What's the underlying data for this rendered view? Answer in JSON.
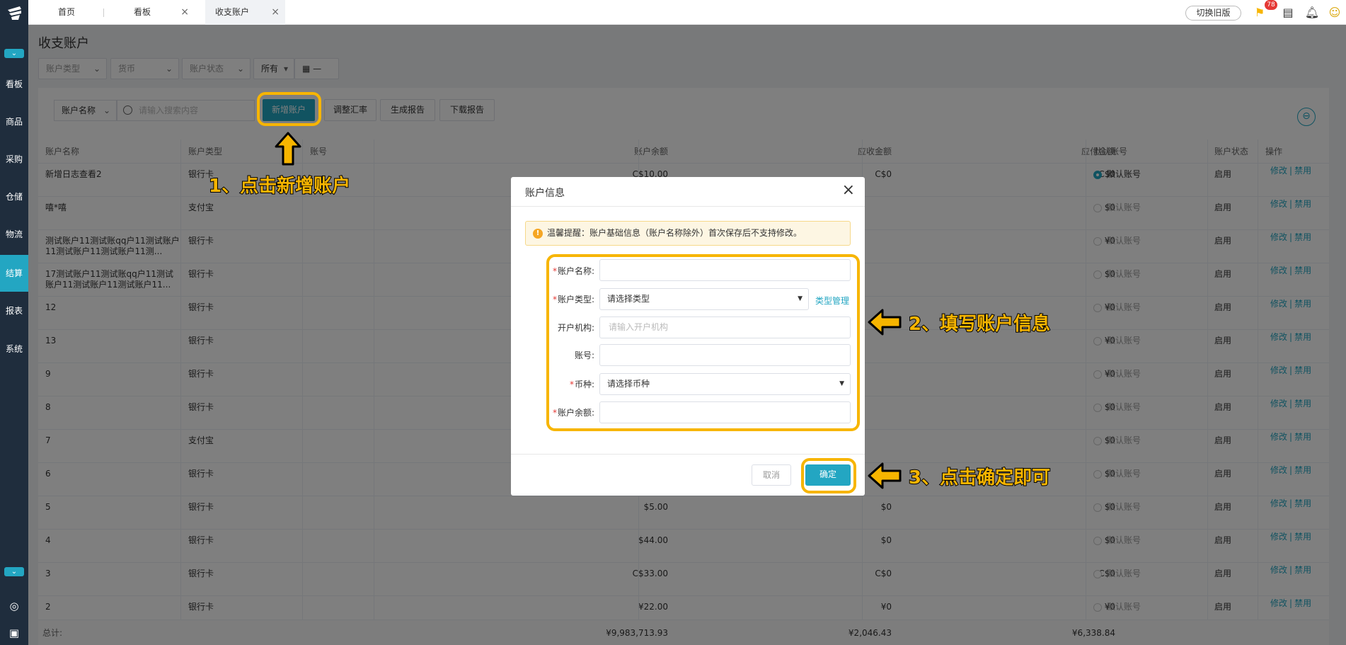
{
  "sidebar": {
    "items": [
      {
        "label": "看板"
      },
      {
        "label": "商品"
      },
      {
        "label": "采购"
      },
      {
        "label": "仓储"
      },
      {
        "label": "物流"
      },
      {
        "label": "结算"
      },
      {
        "label": "报表"
      },
      {
        "label": "系统"
      }
    ]
  },
  "tabs": [
    {
      "label": "首页"
    },
    {
      "label": "看板"
    },
    {
      "label": "收支账户"
    }
  ],
  "top": {
    "old_version": "切换旧版",
    "badge_count": "78"
  },
  "page": {
    "title": "收支账户"
  },
  "filters": {
    "account_type": "账户类型",
    "currency": "货币",
    "account_status": "账户状态",
    "all": "所有",
    "date_dash": "—"
  },
  "toolbar": {
    "field_select": "账户名称",
    "search_placeholder": "请输入搜索内容",
    "add_button": "新增账户",
    "adjust_button": "调整汇率",
    "gen_report": "生成报告",
    "download_report": "下载报告"
  },
  "table": {
    "headers": [
      "账户名称",
      "账户类型",
      "账号",
      "账户余额",
      "应收金额",
      "应付金额",
      "默认账号",
      "账户状态",
      "操作"
    ],
    "default_label": "默认账号",
    "edit_label": "修改",
    "disable_label": "禁用",
    "rows": [
      {
        "name": "新增日志查看2",
        "type": "银行卡",
        "balance": "C$10.00",
        "recv": "C$0",
        "pay": "C$0",
        "status": "启用",
        "default": true
      },
      {
        "name": "嘻*嘻",
        "type": "支付宝",
        "balance": "",
        "recv": "",
        "pay": "$0",
        "status": "启用",
        "default": false
      },
      {
        "name": "测试账户11测试账qq户11测试账户11测试账户11测试账户11测...",
        "type": "银行卡",
        "balance": "",
        "recv": "",
        "pay": "¥0",
        "status": "启用",
        "default": false
      },
      {
        "name": "17测试账户11测试账qq户11测试账户11测试账户11测试账户11...",
        "type": "银行卡",
        "balance": "",
        "recv": "",
        "pay": "$0",
        "status": "启用",
        "default": false
      },
      {
        "name": "12",
        "type": "银行卡",
        "balance": "",
        "recv": "",
        "pay": "¥0",
        "status": "启用",
        "default": false
      },
      {
        "name": "13",
        "type": "银行卡",
        "balance": "",
        "recv": "",
        "pay": "¥0",
        "status": "启用",
        "default": false
      },
      {
        "name": "9",
        "type": "银行卡",
        "balance": "",
        "recv": "",
        "pay": "¥0",
        "status": "启用",
        "default": false
      },
      {
        "name": "8",
        "type": "银行卡",
        "balance": "",
        "recv": "",
        "pay": "$0",
        "status": "启用",
        "default": false
      },
      {
        "name": "7",
        "type": "支付宝",
        "balance": "",
        "recv": "",
        "pay": "$0",
        "status": "启用",
        "default": false
      },
      {
        "name": "6",
        "type": "银行卡",
        "balance": "",
        "recv": "",
        "pay": "$0",
        "status": "启用",
        "default": false
      },
      {
        "name": "5",
        "type": "银行卡",
        "balance": "$5.00",
        "recv": "$0",
        "pay": "$0",
        "status": "启用",
        "default": false
      },
      {
        "name": "4",
        "type": "银行卡",
        "balance": "$44.00",
        "recv": "$0",
        "pay": "$0",
        "status": "启用",
        "default": false
      },
      {
        "name": "3",
        "type": "银行卡",
        "balance": "C$33.00",
        "recv": "C$0",
        "pay": "C$0",
        "status": "启用",
        "default": false
      },
      {
        "name": "2",
        "type": "银行卡",
        "balance": "¥22.00",
        "recv": "¥0",
        "pay": "¥0",
        "status": "启用",
        "default": false
      }
    ],
    "footer": {
      "label": "总计:",
      "balance": "¥9,983,713.93",
      "recv": "¥2,046.43",
      "pay": "¥6,338.84"
    }
  },
  "modal": {
    "title": "账户信息",
    "tip": "温馨提醒：账户基础信息（账户名称除外）首次保存后不支持修改。",
    "fields": {
      "name_label": "账户名称:",
      "type_label": "账户类型:",
      "type_value": "请选择类型",
      "type_manage": "类型管理",
      "bank_label": "开户机构:",
      "bank_placeholder": "请输入开户机构",
      "number_label": "账号:",
      "currency_label": "币种:",
      "currency_value": "请选择币种",
      "balance_label": "账户余额:"
    },
    "cancel": "取消",
    "confirm": "确定"
  },
  "annotations": {
    "step1": "1、点击新增账户",
    "step2": "2、填写账户信息",
    "step3": "3、点击确定即可"
  },
  "colors": {
    "accent": "#23a6c2",
    "sidebar": "#1f2d3d",
    "highlight": "#f7b500"
  }
}
